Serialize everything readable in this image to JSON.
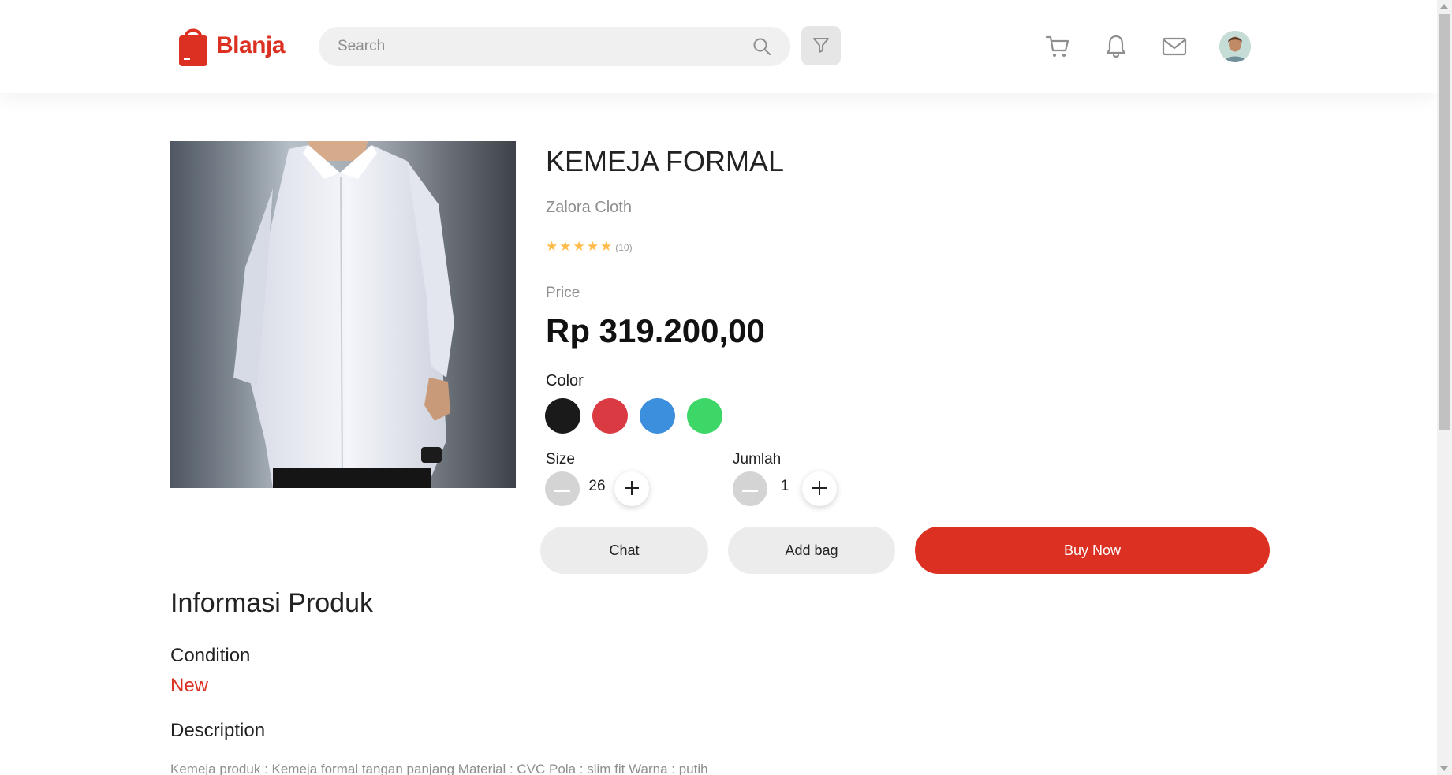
{
  "header": {
    "logo_text": "Blanja",
    "search_placeholder": "Search",
    "icons": [
      "search-icon",
      "filter-icon",
      "cart-icon",
      "bell-icon",
      "mail-icon",
      "avatar"
    ]
  },
  "product": {
    "title": "KEMEJA FORMAL",
    "brand": "Zalora Cloth",
    "rating": 5,
    "rating_count": "(10)",
    "price_label": "Price",
    "price": "Rp 319.200,00",
    "color_label": "Color",
    "colors": [
      "#1a1a1a",
      "#da3b43",
      "#3c8fdc",
      "#3dd768"
    ],
    "size_label": "Size",
    "size_value": "26",
    "qty_label": "Jumlah",
    "qty_value": "1"
  },
  "actions": {
    "chat": "Chat",
    "add_bag": "Add bag",
    "buy_now": "Buy Now"
  },
  "info": {
    "title": "Informasi Produk",
    "condition_label": "Condition",
    "condition_value": "New",
    "description_label": "Description",
    "description_text": "Kemeja produk : Kemeja formal tangan panjang Material : CVC Pola : slim fit Warna : putih"
  },
  "colors": {
    "accent": "#db3022",
    "star": "#ffba49"
  }
}
